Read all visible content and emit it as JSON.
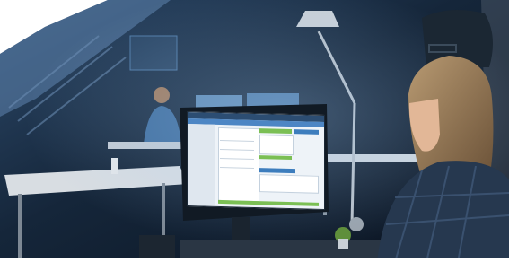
{
  "scene": {
    "kind": "photo",
    "colors": {
      "ambient": "#0d1a2b",
      "window_light": "#3b5f86",
      "monitor_screen": "#eef3f8",
      "ui_green": "#7bbf54",
      "ui_blue": "#3d7dbd",
      "desk": "#d8dde2",
      "shirt_plaid": "#26384f"
    }
  }
}
